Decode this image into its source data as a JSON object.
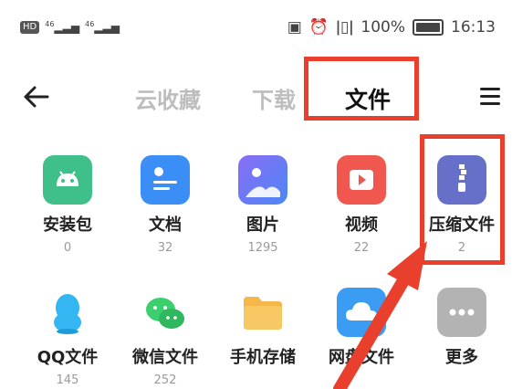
{
  "status": {
    "hd": "HD",
    "signal1": "46",
    "signal2": "46",
    "battery_text": "100%",
    "time": "16:13"
  },
  "nav": {
    "tabs": [
      "云收藏",
      "下载",
      "文件"
    ],
    "active_tab": "文件"
  },
  "files": [
    {
      "name": "安装包",
      "count": "0",
      "icon": "android-icon",
      "color": "#3fc08a"
    },
    {
      "name": "文档",
      "count": "32",
      "icon": "document-icon",
      "color": "#3a8ef5"
    },
    {
      "name": "图片",
      "count": "1295",
      "icon": "image-icon",
      "color": "#6d7df5"
    },
    {
      "name": "视频",
      "count": "22",
      "icon": "video-icon",
      "color": "#f0584f"
    },
    {
      "name": "压缩文件",
      "count": "2",
      "icon": "zip-icon",
      "color": "#6670c9"
    },
    {
      "name": "QQ文件",
      "count": "145",
      "icon": "qq-icon",
      "color": "#33b6f2"
    },
    {
      "name": "微信文件",
      "count": "252",
      "icon": "wechat-icon",
      "color": "#3ccf6e"
    },
    {
      "name": "手机存储",
      "count": "",
      "icon": "folder-icon",
      "color": "#f5b64a"
    },
    {
      "name": "网盘文件",
      "count": "",
      "icon": "cloud-icon",
      "color": "#3b9cf3"
    },
    {
      "name": "更多",
      "count": "",
      "icon": "more-icon",
      "color": "#b3b3b3"
    }
  ],
  "highlight_color": "#e8402d"
}
